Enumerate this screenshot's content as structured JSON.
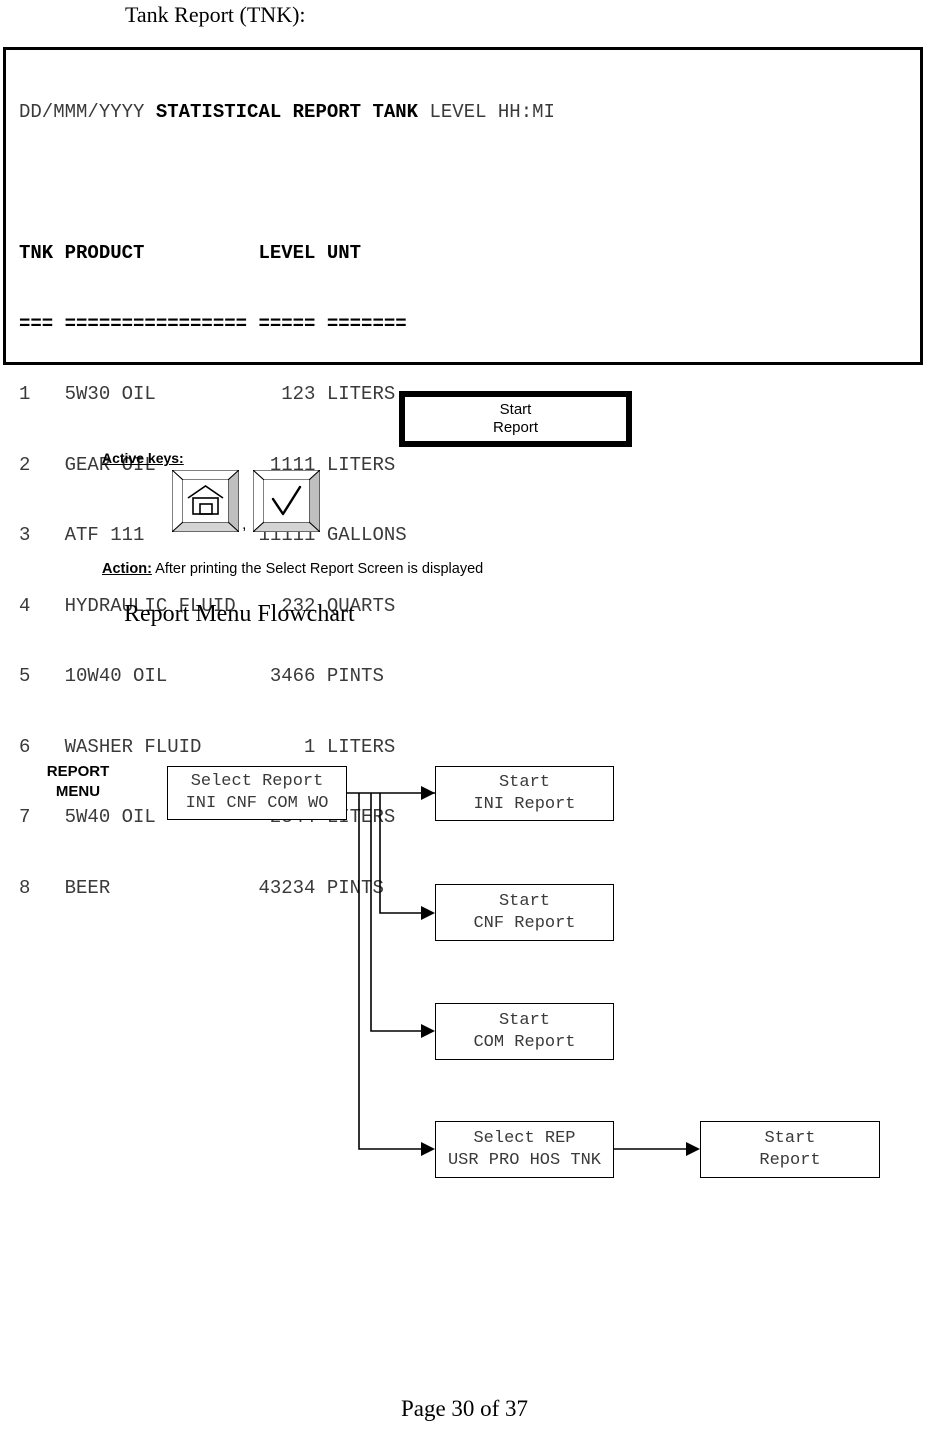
{
  "document": {
    "section_title": "Tank Report (TNK):",
    "flowchart_title": "Report Menu Flowchart",
    "footer": "Page 30 of 37"
  },
  "report": {
    "header": {
      "date": "DD/MMM/YYYY",
      "title": "STATISTICAL REPORT TANK",
      "suffix": "LEVEL HH:MI"
    },
    "columns": [
      "TNK",
      "PRODUCT",
      "LEVEL",
      "UNT"
    ],
    "column_header_line": "TNK PRODUCT          LEVEL UNT",
    "separator_line": "=== ================ ===== =======",
    "rows": [
      {
        "tnk": "1",
        "product": "5W30 OIL",
        "level": "123",
        "unit": "LITERS",
        "line": "1   5W30 OIL           123 LITERS"
      },
      {
        "tnk": "2",
        "product": "GEAR OIL",
        "level": "1111",
        "unit": "LITERS",
        "line": "2   GEAR OIL          1111 LITERS"
      },
      {
        "tnk": "3",
        "product": "ATF 111",
        "level": "11111",
        "unit": "GALLONS",
        "line": "3   ATF 111          11111 GALLONS"
      },
      {
        "tnk": "4",
        "product": "HYDRAULIC FLUID",
        "level": "232",
        "unit": "QUARTS",
        "line": "4   HYDRAULIC FLUID    232 QUARTS"
      },
      {
        "tnk": "5",
        "product": "10W40 OIL",
        "level": "3466",
        "unit": "PINTS",
        "line": "5   10W40 OIL         3466 PINTS"
      },
      {
        "tnk": "6",
        "product": "WASHER FLUID",
        "level": "1",
        "unit": "LITERS",
        "line": "6   WASHER FLUID         1 LITERS"
      },
      {
        "tnk": "7",
        "product": "5W40 OIL",
        "level": "2344",
        "unit": "LITERS",
        "line": "7   5W40 OIL          2344 LITERS"
      },
      {
        "tnk": "8",
        "product": "BEER",
        "level": "43234",
        "unit": "PINTS",
        "line": "8   BEER             43234 PINTS"
      }
    ]
  },
  "start_report_button": {
    "line1": "Start",
    "line2": "Report"
  },
  "active_keys": {
    "label": "Active keys:",
    "separator": ",",
    "keys": [
      {
        "name": "home-key",
        "icon": "home-icon"
      },
      {
        "name": "enter-key",
        "icon": "check-icon"
      }
    ]
  },
  "action": {
    "label": "Action:",
    "text": " After printing the Select Report Screen is displayed"
  },
  "flowchart": {
    "menu_label_line1": "REPORT",
    "menu_label_line2": "MENU",
    "boxes": {
      "select_report": {
        "line1": "Select Report",
        "line2": "INI CNF COM WO"
      },
      "start_ini": {
        "line1": "Start",
        "line2": "INI Report"
      },
      "start_cnf": {
        "line1": "Start",
        "line2": "CNF Report"
      },
      "start_com": {
        "line1": "Start",
        "line2": "COM Report"
      },
      "select_rep": {
        "line1": "Select REP",
        "line2": "USR PRO HOS TNK"
      },
      "start_report": {
        "line1": "Start",
        "line2": "Report"
      }
    }
  },
  "colors": {
    "ink": "#000000",
    "mono_text": "#3a3a3a",
    "bevel_light": "#ffffff",
    "bevel_shadow": "#bfbfbf",
    "bevel_dark": "#000000"
  }
}
